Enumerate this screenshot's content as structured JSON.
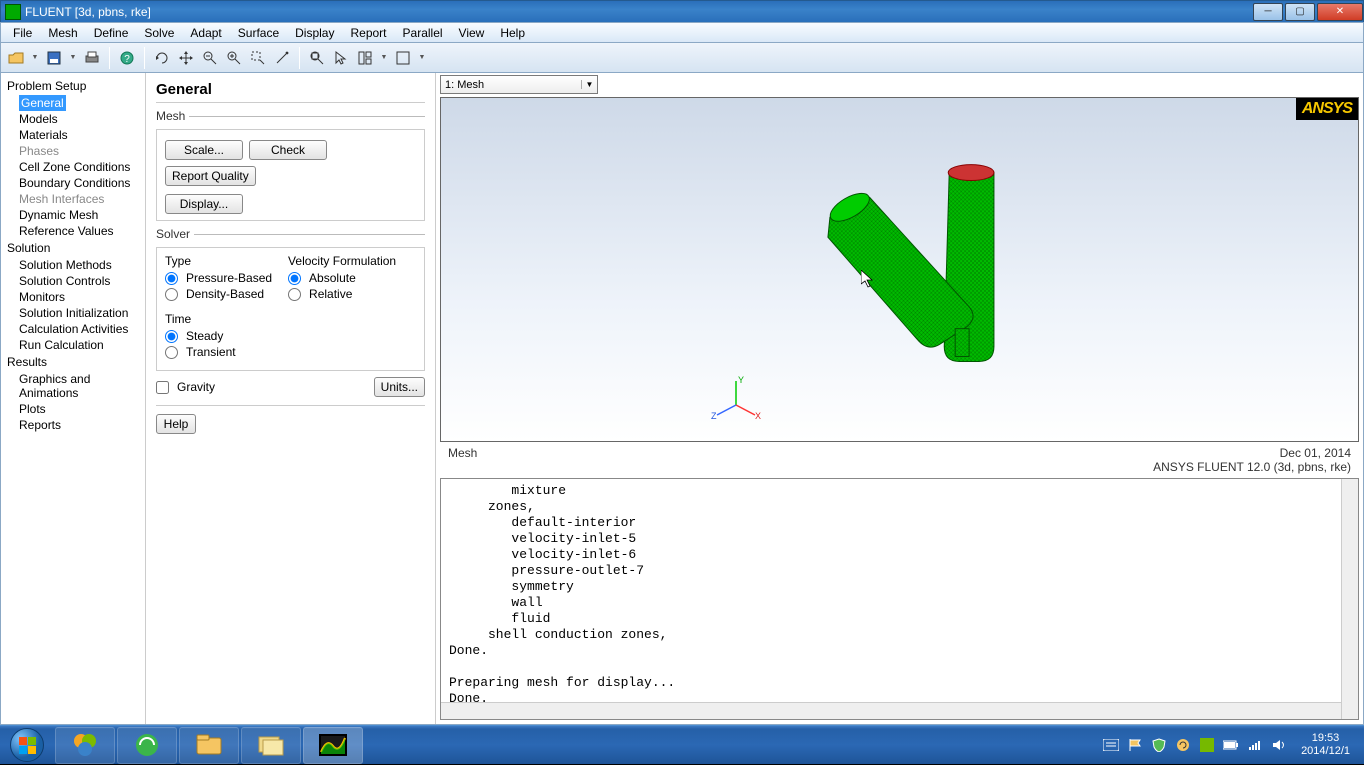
{
  "window": {
    "title": "FLUENT  [3d, pbns, rke]"
  },
  "menu": {
    "items": [
      "File",
      "Mesh",
      "Define",
      "Solve",
      "Adapt",
      "Surface",
      "Display",
      "Report",
      "Parallel",
      "View",
      "Help"
    ]
  },
  "nav": {
    "sections": [
      {
        "title": "Problem Setup",
        "items": [
          {
            "label": "General",
            "selected": true
          },
          {
            "label": "Models"
          },
          {
            "label": "Materials"
          },
          {
            "label": "Phases",
            "disabled": true
          },
          {
            "label": "Cell Zone Conditions"
          },
          {
            "label": "Boundary Conditions"
          },
          {
            "label": "Mesh Interfaces",
            "disabled": true
          },
          {
            "label": "Dynamic Mesh"
          },
          {
            "label": "Reference Values"
          }
        ]
      },
      {
        "title": "Solution",
        "items": [
          {
            "label": "Solution Methods"
          },
          {
            "label": "Solution Controls"
          },
          {
            "label": "Monitors"
          },
          {
            "label": "Solution Initialization"
          },
          {
            "label": "Calculation Activities"
          },
          {
            "label": "Run Calculation"
          }
        ]
      },
      {
        "title": "Results",
        "items": [
          {
            "label": "Graphics and Animations"
          },
          {
            "label": "Plots"
          },
          {
            "label": "Reports"
          }
        ]
      }
    ]
  },
  "task_panel": {
    "title": "General",
    "mesh": {
      "legend": "Mesh",
      "scale": "Scale...",
      "check": "Check",
      "report_quality": "Report Quality",
      "display": "Display..."
    },
    "solver": {
      "legend": "Solver",
      "type_label": "Type",
      "type_options": [
        "Pressure-Based",
        "Density-Based"
      ],
      "type_selected": 0,
      "vf_label": "Velocity Formulation",
      "vf_options": [
        "Absolute",
        "Relative"
      ],
      "vf_selected": 0,
      "time_label": "Time",
      "time_options": [
        "Steady",
        "Transient"
      ],
      "time_selected": 0
    },
    "gravity_label": "Gravity",
    "units_label": "Units...",
    "help_label": "Help"
  },
  "viewport": {
    "selector": "1: Mesh",
    "logo": "ANSYS",
    "status_left": "Mesh",
    "status_date": "Dec 01, 2014",
    "status_version": "ANSYS FLUENT 12.0 (3d, pbns, rke)"
  },
  "console": {
    "text": "        mixture\n     zones,\n        default-interior\n        velocity-inlet-5\n        velocity-inlet-6\n        pressure-outlet-7\n        symmetry\n        wall\n        fluid\n     shell conduction zones,\nDone.\n\nPreparing mesh for display...\nDone."
  },
  "taskbar": {
    "time": "19:53",
    "date": "2014/12/1"
  }
}
